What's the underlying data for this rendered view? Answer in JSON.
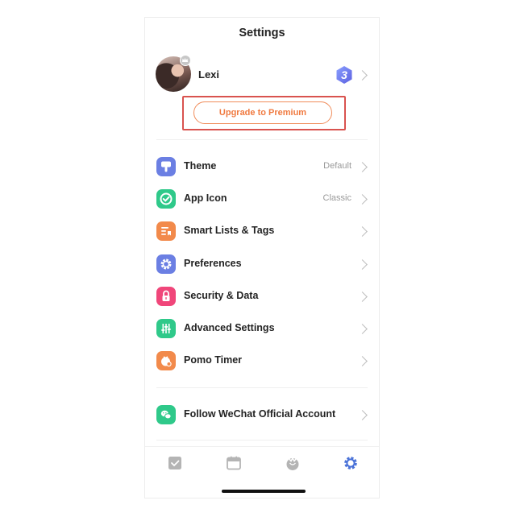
{
  "header": {
    "title": "Settings"
  },
  "profile": {
    "username": "Lexi",
    "level": "3"
  },
  "upgrade": {
    "label": "Upgrade to Premium"
  },
  "menu": {
    "items": [
      {
        "label": "Theme",
        "value": "Default",
        "icon": "theme-icon",
        "color": "#6b7fe3"
      },
      {
        "label": "App Icon",
        "value": "Classic",
        "icon": "app-icon-icon",
        "color": "#2fc98a"
      },
      {
        "label": "Smart Lists & Tags",
        "value": "",
        "icon": "smart-lists-icon",
        "color": "#f28a4b"
      },
      {
        "label": "Preferences",
        "value": "",
        "icon": "gear-icon",
        "color": "#6b7fe3"
      },
      {
        "label": "Security & Data",
        "value": "",
        "icon": "lock-icon",
        "color": "#f0467a"
      },
      {
        "label": "Advanced Settings",
        "value": "",
        "icon": "sliders-icon",
        "color": "#2fc98a"
      },
      {
        "label": "Pomo Timer",
        "value": "",
        "icon": "pomo-icon",
        "color": "#f28a4b"
      }
    ],
    "social": {
      "label": "Follow WeChat Official Account",
      "icon": "wechat-icon",
      "color": "#2fc98a"
    }
  },
  "tabbar": {
    "tabs": [
      {
        "icon": "checkbox-icon",
        "active": false
      },
      {
        "icon": "calendar-icon",
        "active": false
      },
      {
        "icon": "pomo-tab-icon",
        "active": false
      },
      {
        "icon": "settings-gear-icon",
        "active": true
      }
    ],
    "active_color": "#4a72d8",
    "inactive_color": "#b4b4b4"
  }
}
